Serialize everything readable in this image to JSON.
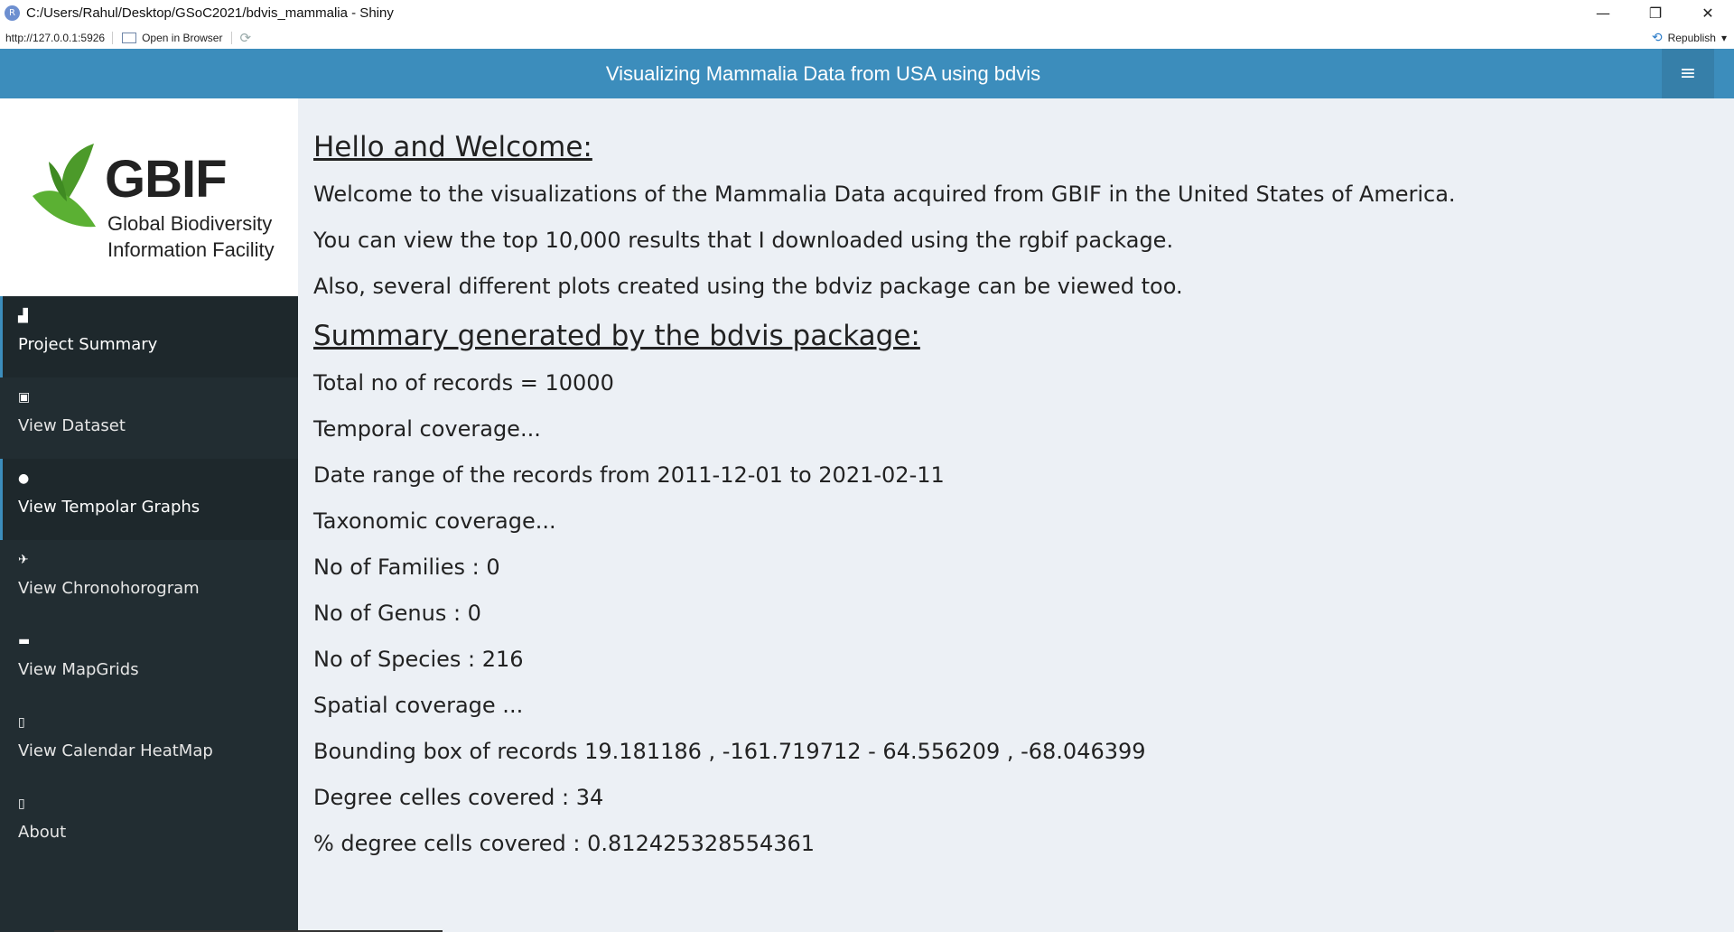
{
  "window": {
    "title": "C:/Users/Rahul/Desktop/GSoC2021/bdvis_mammalia - Shiny",
    "app_icon_letter": "R",
    "controls": {
      "minimize": "—",
      "restore": "❐",
      "close": "✕"
    }
  },
  "toolbar": {
    "url": "http://127.0.0.1:5926",
    "open_in_browser": "Open in Browser",
    "refresh_icon": "⟳",
    "republish": "Republish",
    "republish_caret": "▾"
  },
  "header": {
    "title": "Visualizing Mammalia Data from USA using bdvis",
    "menu_icon": "≡"
  },
  "logo": {
    "name": "GBIF",
    "line1": "Global Biodiversity",
    "line2": "Information Facility"
  },
  "sidebar": {
    "items": [
      {
        "label": "Project Summary",
        "icon": "chart-icon",
        "glyph": "▟",
        "active": true
      },
      {
        "label": "View Dataset",
        "icon": "id-card-icon",
        "glyph": "▣",
        "active": false
      },
      {
        "label": "View Tempolar Graphs",
        "icon": "globe-icon",
        "glyph": "●",
        "active": true
      },
      {
        "label": "View Chronohorogram",
        "icon": "rocket-icon",
        "glyph": "✈",
        "active": false
      },
      {
        "label": "View MapGrids",
        "icon": "graduation-cap-icon",
        "glyph": "▬",
        "active": false
      },
      {
        "label": "View Calendar HeatMap",
        "icon": "clipboard-icon",
        "glyph": "▯",
        "active": false
      },
      {
        "label": "About",
        "icon": "clipboard-icon",
        "glyph": "▯",
        "active": false
      }
    ]
  },
  "main": {
    "welcome_heading": "Hello and Welcome:",
    "welcome_lines": [
      "Welcome to the visualizations of the Mammalia Data acquired from GBIF in the United States of America.",
      "You can view the top 10,000 results that I downloaded using the rgbif package.",
      "Also, several different plots created using the bdviz package can be viewed too."
    ],
    "summary_heading": "Summary generated by the bdvis package:",
    "summary_lines": [
      "Total no of records = 10000",
      "Temporal coverage...",
      "Date range of the records from 2011-12-01 to 2021-02-11",
      "Taxonomic coverage...",
      "No of Families : 0",
      "No of Genus : 0",
      "No of Species : 216",
      "Spatial coverage ...",
      "Bounding box of records 19.181186 , -161.719712 - 64.556209 , -68.046399",
      "Degree celles covered : 34",
      "% degree cells covered : 0.812425328554361"
    ]
  }
}
